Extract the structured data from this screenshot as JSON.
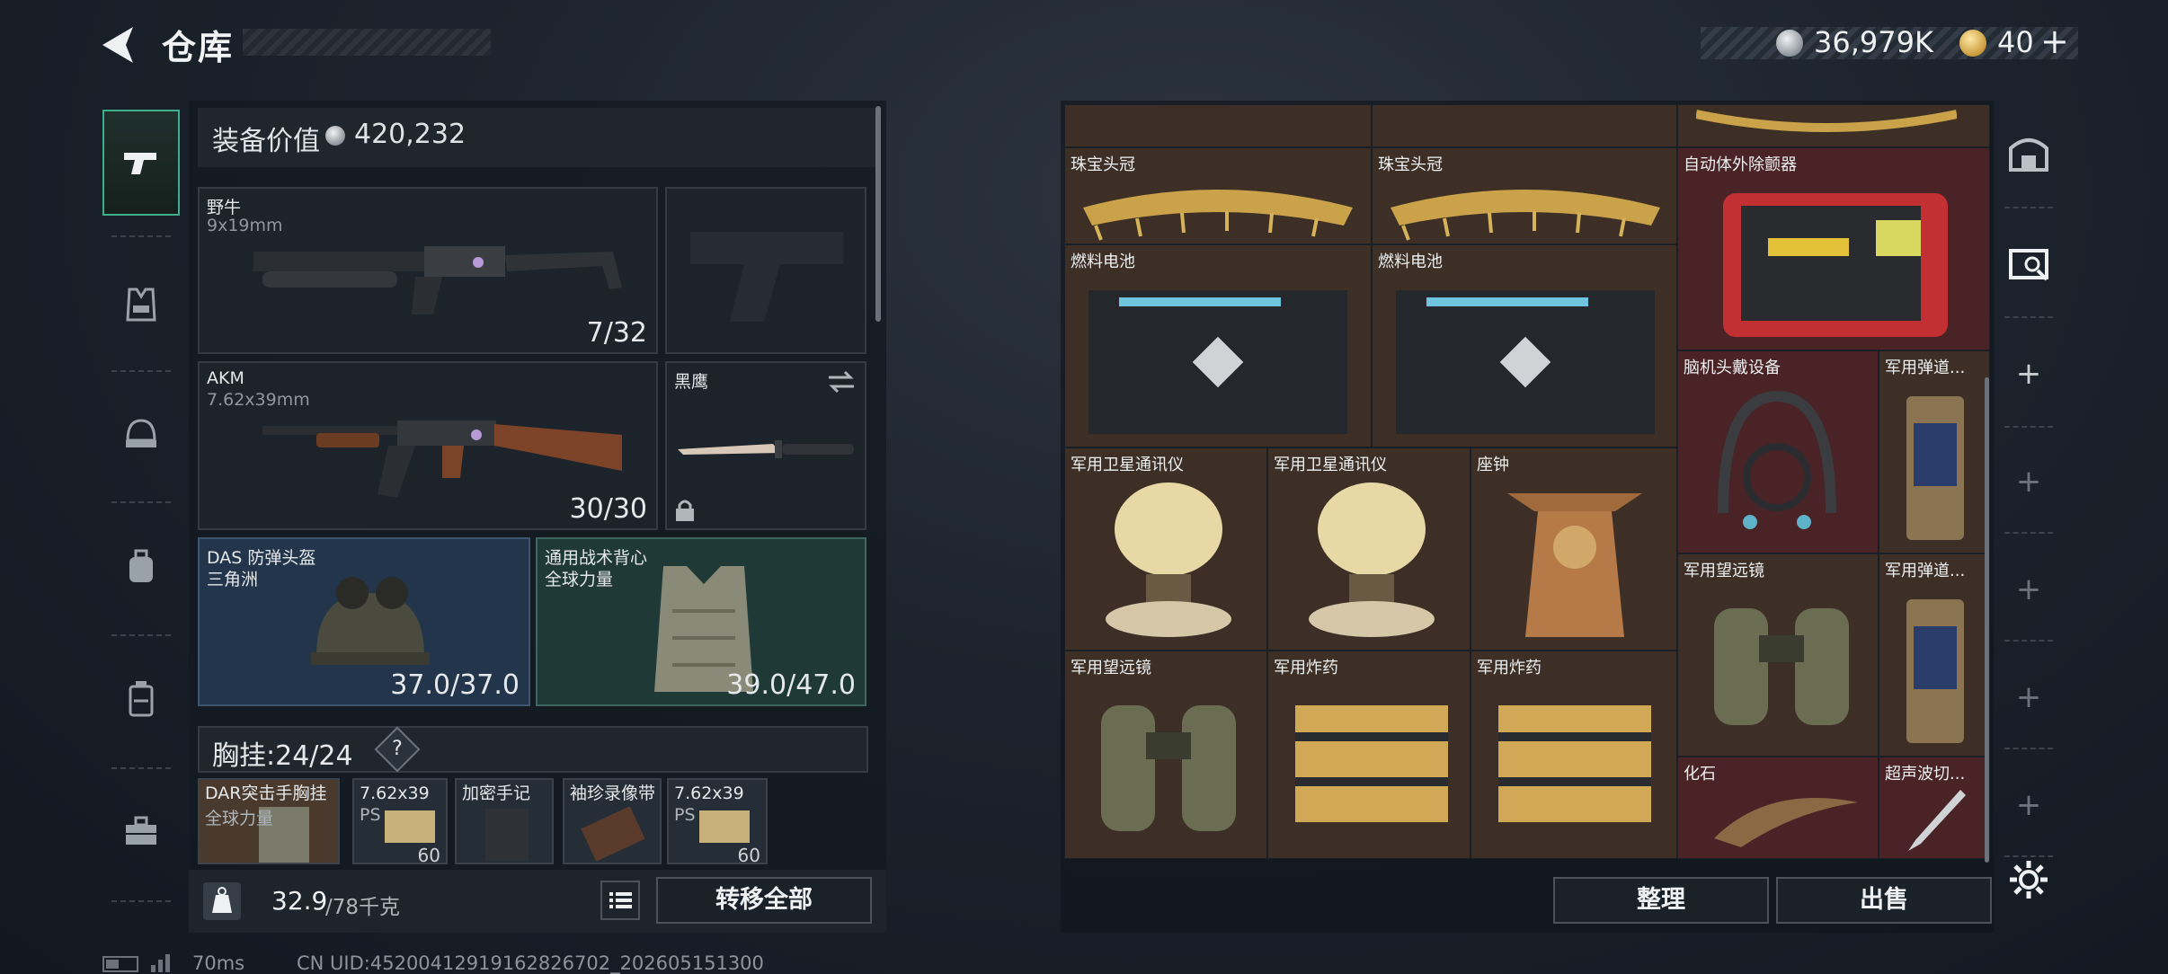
{
  "header": {
    "title": "仓库",
    "silver": "36,979K",
    "gold": "40",
    "gold_add": "+"
  },
  "left_nav": {
    "tabs": [
      "pistol-icon",
      "rig-icon",
      "helmet-icon",
      "backpack-icon",
      "case-icon",
      "toolbox-icon"
    ]
  },
  "loadout": {
    "equip_label": "装备价值",
    "equip_value": "420,232",
    "weapon1": {
      "name": "野牛",
      "caliber": "9x19mm",
      "ammo": "7/32"
    },
    "weapon2": {
      "name": "AKM",
      "caliber": "7.62x39mm",
      "ammo": "30/30"
    },
    "melee": {
      "name": "黑鹰"
    },
    "helmet": {
      "name": "DAS 防弹头盔",
      "sub": "三角洲",
      "durability": "37.0/37.0"
    },
    "vest": {
      "name": "通用战术背心",
      "sub": "全球力量",
      "durability": "39.0/47.0"
    },
    "rig": {
      "label": "胸挂:",
      "count": "24/24",
      "help": "?",
      "items": [
        {
          "name": "DAR突击手胸挂",
          "sub": "全球力量",
          "count": ""
        },
        {
          "name": "7.62x39",
          "sub": "PS",
          "count": "60"
        },
        {
          "name": "加密手记",
          "sub": "",
          "count": ""
        },
        {
          "name": "袖珍录像带",
          "sub": "",
          "count": ""
        },
        {
          "name": "7.62x39",
          "sub": "PS",
          "count": "60"
        }
      ]
    }
  },
  "bottom": {
    "weight": "32.9",
    "weight_cap": "/78千克",
    "transfer": "转移全部"
  },
  "status": {
    "ping": "70ms",
    "uid": "CN UID:4520041291916282670​2_202605151300"
  },
  "stash": {
    "items": [
      {
        "name": "珠宝头冠",
        "color": "brown"
      },
      {
        "name": "珠宝头冠",
        "color": "brown"
      },
      {
        "name": "自动体外除颤器",
        "color": "red"
      },
      {
        "name": "燃料电池",
        "color": "brown"
      },
      {
        "name": "燃料电池",
        "color": "brown"
      },
      {
        "name": "脑机头戴设备",
        "color": "red"
      },
      {
        "name": "军用弹道...",
        "color": "brown"
      },
      {
        "name": "军用卫星通讯仪",
        "color": "brown"
      },
      {
        "name": "军用卫星通讯仪",
        "color": "brown"
      },
      {
        "name": "座钟",
        "color": "brown"
      },
      {
        "name": "军用望远镜",
        "color": "brown"
      },
      {
        "name": "军用弹道...",
        "color": "brown"
      },
      {
        "name": "军用望远镜",
        "color": "brown"
      },
      {
        "name": "军用炸药",
        "color": "brown"
      },
      {
        "name": "军用炸药",
        "color": "brown"
      },
      {
        "name": "化石",
        "color": "red"
      },
      {
        "name": "超声波切...",
        "color": "red"
      }
    ],
    "sort": "整理",
    "sell": "出售"
  }
}
